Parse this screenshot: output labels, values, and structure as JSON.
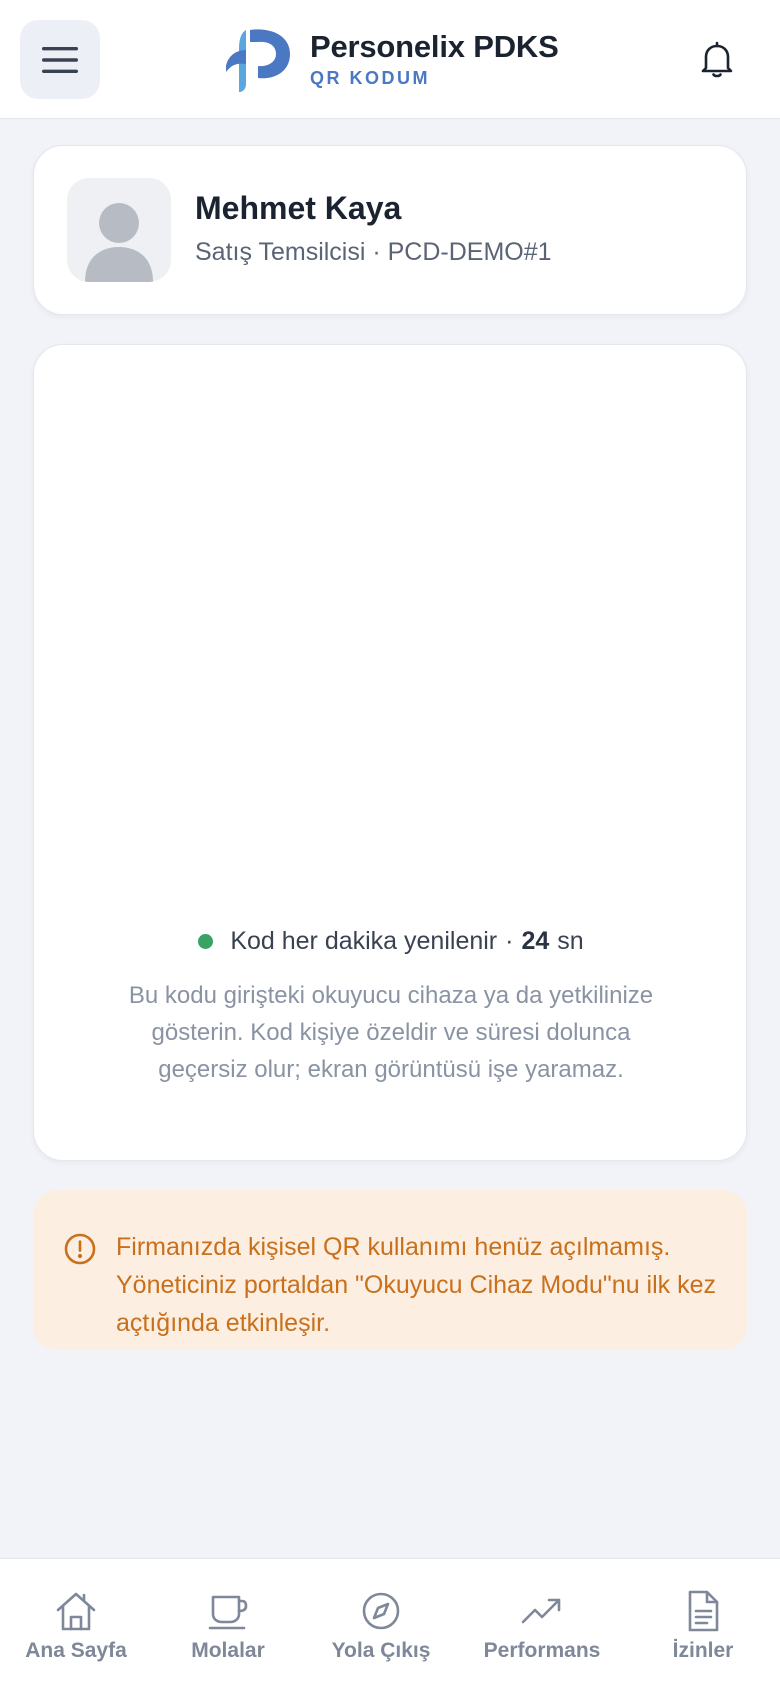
{
  "header": {
    "menu_icon": "hamburger-menu-icon",
    "brand_title": "Personelix PDKS",
    "brand_subtitle": "QR KODUM",
    "notification_icon": "bell-icon",
    "colors": {
      "brand_blue": "#4a78c2",
      "brand_light_blue": "#5aa7e0"
    }
  },
  "profile": {
    "name": "Mehmet Kaya",
    "role": "Satış Temsilcisi · PCD-DEMO#1",
    "avatar_icon": "user-placeholder-icon"
  },
  "qr": {
    "refresh_text": "Kod her dakika yenilenir",
    "separator": "·",
    "seconds_value": "24",
    "seconds_unit": "sn",
    "hint": "Bu kodu girişteki okuyucu cihaza ya da yetkilinize gösterin. Kod kişiye özeldir ve süresi dolunca geçersiz olur; ekran görüntüsü işe yaramaz.",
    "status_color": "#3aa266"
  },
  "warning": {
    "icon": "alert-circle-icon",
    "text": "Firmanızda kişisel QR kullanımı henüz açılmamış. Yöneticiniz portaldan \"Okuyucu Cihaz Modu\"nu ilk kez açtığında etkinleşir.",
    "color": "#c8701b",
    "background": "#fdeee2"
  },
  "nav": {
    "items": [
      {
        "label": "Ana Sayfa",
        "icon": "home-icon"
      },
      {
        "label": "Molalar",
        "icon": "coffee-cup-icon"
      },
      {
        "label": "Yola Çıkış",
        "icon": "compass-icon"
      },
      {
        "label": "Performans",
        "icon": "trending-up-icon"
      },
      {
        "label": "İzinler",
        "icon": "document-icon"
      }
    ]
  }
}
